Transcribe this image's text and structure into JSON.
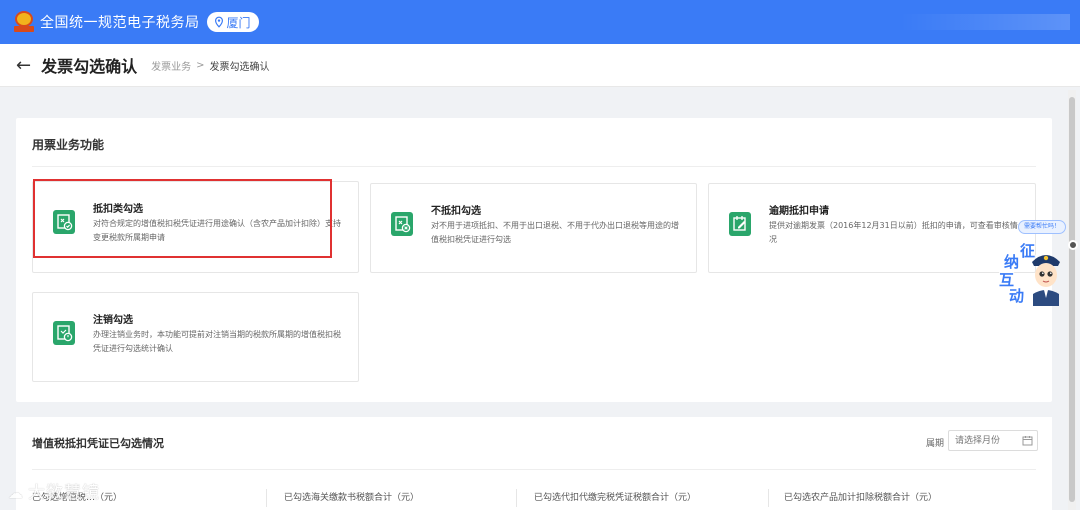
{
  "topbar": {
    "brand": "全国统一规范电子税务局",
    "city": "厦门",
    "bg_color": "#3a7bf6"
  },
  "header": {
    "back_icon": "arrow-left-icon",
    "title": "发票勾选确认",
    "breadcrumb": {
      "parent": "发票业务",
      "separator": ">",
      "current": "发票勾选确认"
    }
  },
  "functions": {
    "title": "用票业务功能",
    "cards": [
      {
        "icon": "check-ticket-icon",
        "title": "抵扣类勾选",
        "desc": "对符合规定的增值税扣税凭证进行用途确认（含农产品加计扣除）支持变更税款所属期申请"
      },
      {
        "icon": "ticket-cross-icon",
        "title": "不抵扣勾选",
        "desc": "对不用于进项抵扣、不用于出口退税、不用于代办出口退税等用途的增值税扣税凭证进行勾选"
      },
      {
        "icon": "overdue-edit-icon",
        "title": "逾期抵扣申请",
        "desc": "提供对逾期发票（2016年12月31日以前）抵扣的申请，可查看审核情况"
      },
      {
        "icon": "cancel-power-icon",
        "title": "注销勾选",
        "desc": "办理注销业务时，本功能可提前对注销当期的税款所属期的增值税扣税凭证进行勾选统计确认"
      }
    ],
    "accent_color": "#2aa66b",
    "highlight_color": "#e03131"
  },
  "summary": {
    "title": "增值税抵扣凭证已勾选情况",
    "period_label": "属期",
    "period_placeholder": "请选择月份",
    "stats": [
      "已勾选增值税…（元）",
      "已勾选海关缴款书税额合计（元）",
      "已勾选代扣代缴完税凭证税额合计（元）",
      "已勾选农产品加计扣除税额合计（元）"
    ]
  },
  "assistant": {
    "bubble": "需要帮忙吗！",
    "chars": [
      "征",
      "纳",
      "互",
      "动"
    ]
  },
  "watermark": "大数慧镜"
}
